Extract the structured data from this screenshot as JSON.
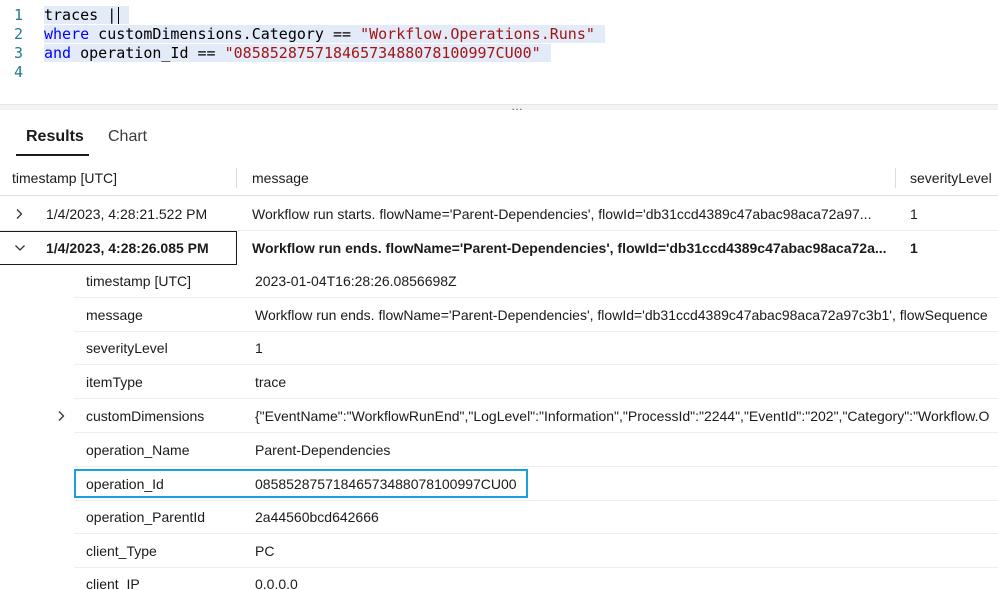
{
  "editor": {
    "lines": [
      {
        "num": "1",
        "tokens": {
          "a": "traces |"
        }
      },
      {
        "num": "2",
        "tokens": {
          "kw": "where",
          "a": " customDimensions.Category ",
          "op": "==",
          "str": " \"Workflow.Operations.Runs\""
        }
      },
      {
        "num": "3",
        "tokens": {
          "kw": "and",
          "a": " operation_Id ",
          "op": "==",
          "str": " \"08585287571846573488078100997CU00\""
        }
      },
      {
        "num": "4",
        "tokens": {}
      }
    ],
    "splitter_grip": "…"
  },
  "tabs": [
    {
      "label": "Results",
      "active": true
    },
    {
      "label": "Chart",
      "active": false
    }
  ],
  "grid": {
    "columns": [
      "timestamp [UTC]",
      "message",
      "severityLevel"
    ],
    "rows": [
      {
        "timestamp": "1/4/2023, 4:28:21.522 PM",
        "message": "Workflow run starts. flowName='Parent-Dependencies', flowId='db31ccd4389c47abac98aca72a97...",
        "severity": "1",
        "expanded": false
      },
      {
        "timestamp": "1/4/2023, 4:28:26.085 PM",
        "message": "Workflow run ends. flowName='Parent-Dependencies', flowId='db31ccd4389c47abac98aca72a...",
        "severity": "1",
        "expanded": true
      }
    ],
    "details": [
      {
        "key": "timestamp [UTC]",
        "value": "2023-01-04T16:28:26.0856698Z"
      },
      {
        "key": "message",
        "value": "Workflow run ends. flowName='Parent-Dependencies', flowId='db31ccd4389c47abac98aca72a97c3b1', flowSequence"
      },
      {
        "key": "severityLevel",
        "value": "1"
      },
      {
        "key": "itemType",
        "value": "trace"
      },
      {
        "key": "customDimensions",
        "value": "{\"EventName\":\"WorkflowRunEnd\",\"LogLevel\":\"Information\",\"ProcessId\":\"2244\",\"EventId\":\"202\",\"Category\":\"Workflow.O"
      },
      {
        "key": "operation_Name",
        "value": "Parent-Dependencies"
      },
      {
        "key": "operation_Id",
        "value": "08585287571846573488078100997CU00"
      },
      {
        "key": "operation_ParentId",
        "value": "2a44560bcd642666"
      },
      {
        "key": "client_Type",
        "value": "PC"
      },
      {
        "key": "client_IP",
        "value": "0.0.0.0"
      }
    ]
  },
  "colors": {
    "highlight": "#1aa0dc",
    "keyword": "#0000ff",
    "string": "#a31515",
    "line_number": "#237893"
  },
  "icons": {
    "collapsed": "chevron-right-icon",
    "expanded": "chevron-down-icon"
  }
}
